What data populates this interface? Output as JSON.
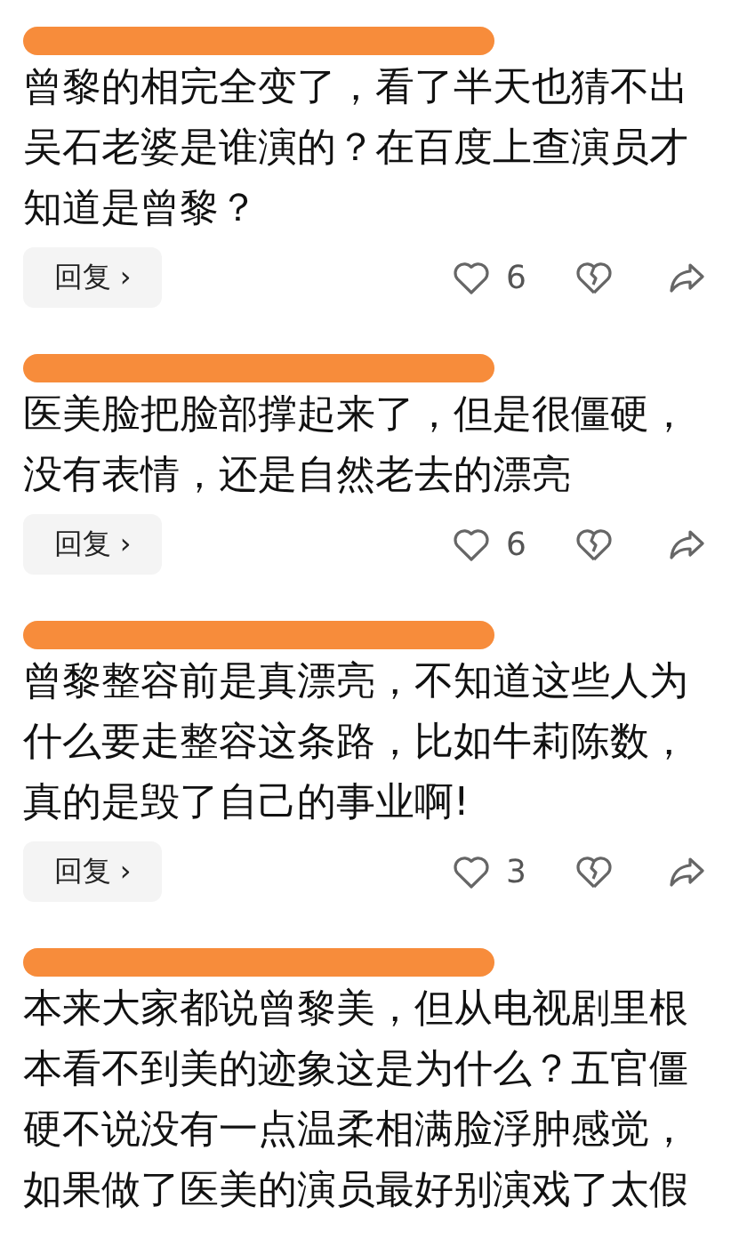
{
  "comments": [
    {
      "author_redacted": true,
      "text": "曾黎的相完全变了，看了半天也猜不出吴石老婆是谁演的？在百度上查演员才知道是曾黎？",
      "reply_label": "回复 ›",
      "likes": "6"
    },
    {
      "author_redacted": true,
      "text": "医美脸把脸部撑起来了，但是很僵硬，没有表情，还是自然老去的漂亮",
      "reply_label": "回复 ›",
      "likes": "6"
    },
    {
      "author_redacted": true,
      "text": "曾黎整容前是真漂亮，不知道这些人为什么要走整容这条路，比如牛莉陈数，真的是毁了自己的事业啊!",
      "reply_label": "回复 ›",
      "likes": "3"
    },
    {
      "author_redacted": true,
      "text": "本来大家都说曾黎美，但从电视剧里根本看不到美的迹象这是为什么？五官僵硬不说没有一点温柔相满脸浮肿感觉，如果做了医美的演员最好别演戏了太假"
    }
  ]
}
